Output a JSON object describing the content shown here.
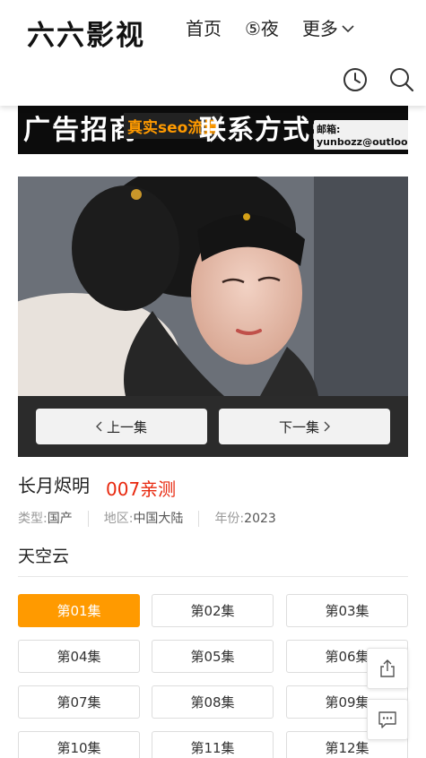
{
  "header": {
    "logo": "六六影视",
    "nav": [
      {
        "label": "首页"
      },
      {
        "label": "⑤夜"
      },
      {
        "label": "更多"
      }
    ],
    "icons": [
      "clock-icon",
      "search-icon"
    ]
  },
  "ad": {
    "part1": "广告招商",
    "part2": "真实seo流量",
    "part3": "联系方式:",
    "email": "邮箱: yunbozz@outlook.com"
  },
  "player": {
    "prev_label": "上一集",
    "next_label": "下一集"
  },
  "info": {
    "title": "长月烬明",
    "tag": "007亲测",
    "meta": [
      {
        "key": "类型:",
        "value": "国产"
      },
      {
        "key": "地区:",
        "value": "中国大陆"
      },
      {
        "key": "年份:",
        "value": "2023"
      }
    ],
    "source": "天空云"
  },
  "episodes": [
    {
      "label": "第01集",
      "active": true
    },
    {
      "label": "第02集",
      "active": false
    },
    {
      "label": "第03集",
      "active": false
    },
    {
      "label": "第04集",
      "active": false
    },
    {
      "label": "第05集",
      "active": false
    },
    {
      "label": "第06集",
      "active": false
    },
    {
      "label": "第07集",
      "active": false
    },
    {
      "label": "第08集",
      "active": false
    },
    {
      "label": "第09集",
      "active": false
    },
    {
      "label": "第10集",
      "active": false
    },
    {
      "label": "第11集",
      "active": false
    },
    {
      "label": "第12集",
      "active": false
    }
  ],
  "floating": [
    "share-icon",
    "comment-icon"
  ],
  "colors": {
    "accent": "#ff9a00",
    "tag": "#e8280e"
  }
}
